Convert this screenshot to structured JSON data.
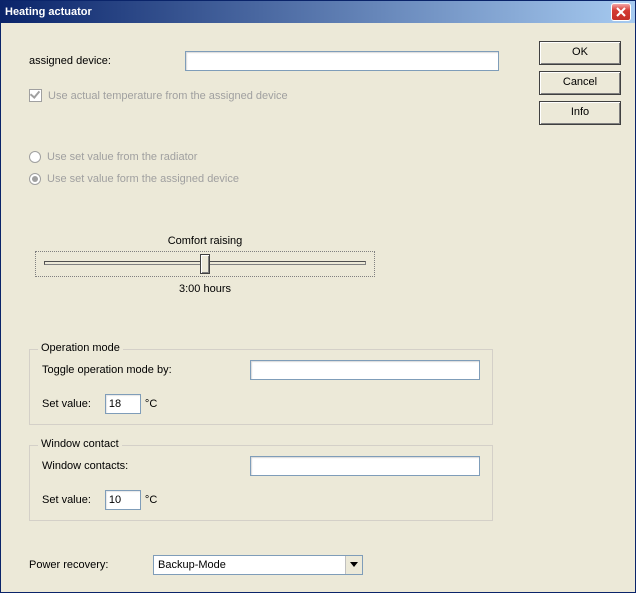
{
  "window": {
    "title": "Heating actuator"
  },
  "buttons": {
    "ok": "OK",
    "cancel": "Cancel",
    "info": "Info"
  },
  "assigned_device": {
    "label": "assigned device:",
    "value": ""
  },
  "use_actual_temp": {
    "label": "Use actual temperature from the assigned device",
    "checked": true
  },
  "radios": {
    "from_radiator": "Use set value from the radiator",
    "from_assigned": "Use set value form the assigned device",
    "selected": "from_assigned"
  },
  "comfort": {
    "caption": "Comfort raising",
    "value_text": "3:00 hours",
    "thumb_percent": 50
  },
  "operation_mode": {
    "legend": "Operation mode",
    "toggle_label": "Toggle operation mode by:",
    "toggle_value": "",
    "setvalue_label": "Set value:",
    "setvalue": "18",
    "unit": "°C"
  },
  "window_contact": {
    "legend": "Window contact",
    "contacts_label": "Window contacts:",
    "contacts_value": "",
    "setvalue_label": "Set value:",
    "setvalue": "10",
    "unit": "°C"
  },
  "power_recovery": {
    "label": "Power recovery:",
    "selected": "Backup-Mode"
  }
}
